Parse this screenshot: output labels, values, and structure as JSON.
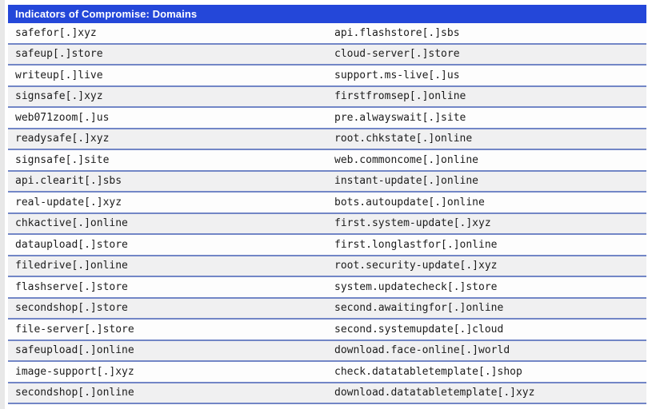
{
  "header": {
    "title": "Indicators of Compromise: Domains"
  },
  "table": {
    "rows": [
      {
        "left": "safefor[.]xyz",
        "right": "api.flashstore[.]sbs"
      },
      {
        "left": "safeup[.]store",
        "right": "cloud-server[.]store"
      },
      {
        "left": "writeup[.]live",
        "right": "support.ms-live[.]us"
      },
      {
        "left": "signsafe[.]xyz",
        "right": "firstfromsep[.]online"
      },
      {
        "left": "web071zoom[.]us",
        "right": "pre.alwayswait[.]site"
      },
      {
        "left": "readysafe[.]xyz",
        "right": "root.chkstate[.]online"
      },
      {
        "left": "signsafe[.]site",
        "right": "web.commoncome[.]online"
      },
      {
        "left": "api.clearit[.]sbs",
        "right": "instant-update[.]online"
      },
      {
        "left": "real-update[.]xyz",
        "right": "bots.autoupdate[.]online"
      },
      {
        "left": "chkactive[.]online",
        "right": "first.system-update[.]xyz"
      },
      {
        "left": "dataupload[.]store",
        "right": "first.longlastfor[.]online"
      },
      {
        "left": "filedrive[.]online",
        "right": "root.security-update[.]xyz"
      },
      {
        "left": "flashserve[.]store",
        "right": "system.updatecheck[.]store"
      },
      {
        "left": "secondshop[.]store",
        "right": "second.awaitingfor[.]online"
      },
      {
        "left": "file-server[.]store",
        "right": "second.systemupdate[.]cloud"
      },
      {
        "left": "safeupload[.]online",
        "right": "download.face-online[.]world"
      },
      {
        "left": "image-support[.]xyz",
        "right": "check.datatabletemplate[.]shop"
      },
      {
        "left": "secondshop[.]online",
        "right": "download.datatabletemplate[.]xyz"
      }
    ]
  },
  "colors": {
    "header_bg": "#2447d9",
    "header_fg": "#ffffff",
    "separator": "#7286c6",
    "row_bg": "#fdfdfd",
    "row_alt_bg": "#f0f0f1",
    "text": "#1c1c1c",
    "left_strip": "#e8e8e8"
  }
}
